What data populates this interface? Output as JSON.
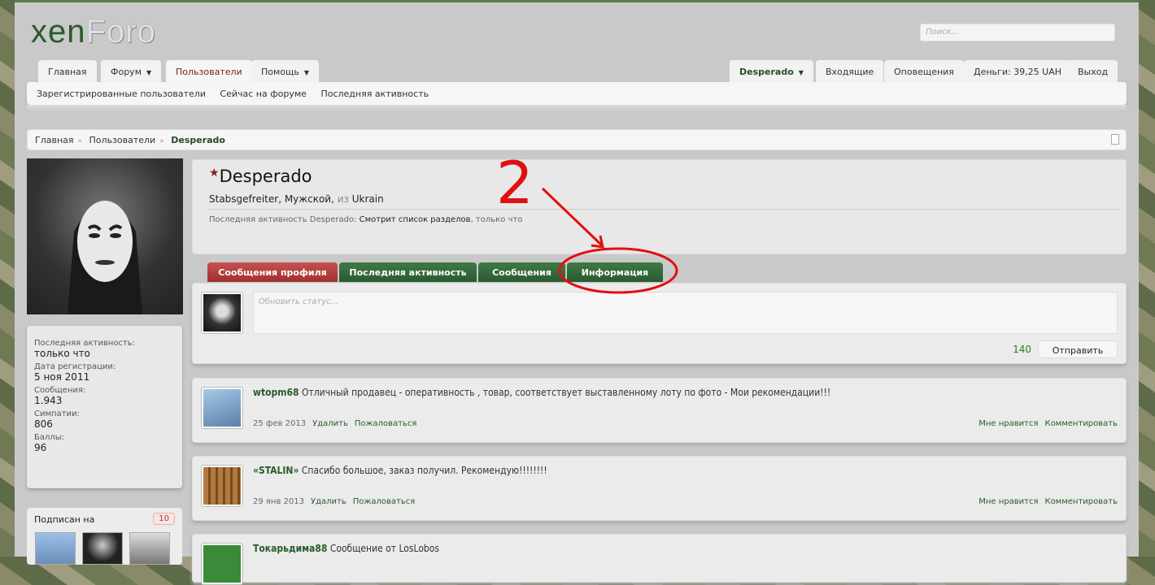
{
  "logo": {
    "part1": "xen",
    "part2": "Foro"
  },
  "search": {
    "placeholder": "Поиск..."
  },
  "nav": {
    "left": [
      {
        "label": "Главная"
      },
      {
        "label": "Форум"
      },
      {
        "label": "Пользователи"
      },
      {
        "label": "Помощь"
      }
    ],
    "right": [
      {
        "label": "Desperado"
      },
      {
        "label": "Входящие"
      },
      {
        "label": "Оповещения"
      },
      {
        "label": "Деньги: 39,25 UAH"
      },
      {
        "label": "Выход"
      }
    ]
  },
  "subnav": [
    "Зарегистрированные пользователи",
    "Сейчас на форуме",
    "Последняя активность"
  ],
  "breadcrumb": [
    "Главная",
    "Пользователи",
    "Desperado"
  ],
  "sidebar": {
    "stats": [
      {
        "label": "Последняя активность:",
        "value": "только что"
      },
      {
        "label": "Дата регистрации:",
        "value": "5 ноя 2011"
      },
      {
        "label": "Сообщения:",
        "value": "1.943"
      },
      {
        "label": "Симпатии:",
        "value": "806"
      },
      {
        "label": "Баллы:",
        "value": "96"
      }
    ],
    "following": {
      "label": "Подписан на",
      "count": "10"
    }
  },
  "profile": {
    "name": "Desperado",
    "title": "Stabsgefreiter",
    "gender": "Мужской",
    "from_prefix": "из",
    "location": "Ukrain",
    "activity_prefix": "Последняя активность Desperado:",
    "activity": "Смотрит список разделов",
    "activity_time": "только что"
  },
  "tabs": [
    "Сообщения профиля",
    "Последняя активность",
    "Сообщения",
    "Информация"
  ],
  "status": {
    "placeholder": "Обновить статус...",
    "counter": "140",
    "submit": "Отправить"
  },
  "posts": [
    {
      "user": "wtopm68",
      "text": "Отличный продавец - оперативность , товар, соответствует выставленному лоту по фото - Мои рекомендации!!!",
      "date": "25 фев 2013",
      "delete": "Удалить",
      "report": "Пожаловаться",
      "like": "Мне нравится",
      "comment": "Комментировать"
    },
    {
      "user": "«STALIN»",
      "text": "Спасибо большое, заказ получил. Рекомендую!!!!!!!!",
      "date": "29 янв 2013",
      "delete": "Удалить",
      "report": "Пожаловаться",
      "like": "Мне нравится",
      "comment": "Комментировать"
    },
    {
      "user": "Токарьдима88",
      "text": "Сообщение от LosLobos"
    }
  ],
  "annotation": {
    "number": "2",
    "color": "#e01010"
  }
}
